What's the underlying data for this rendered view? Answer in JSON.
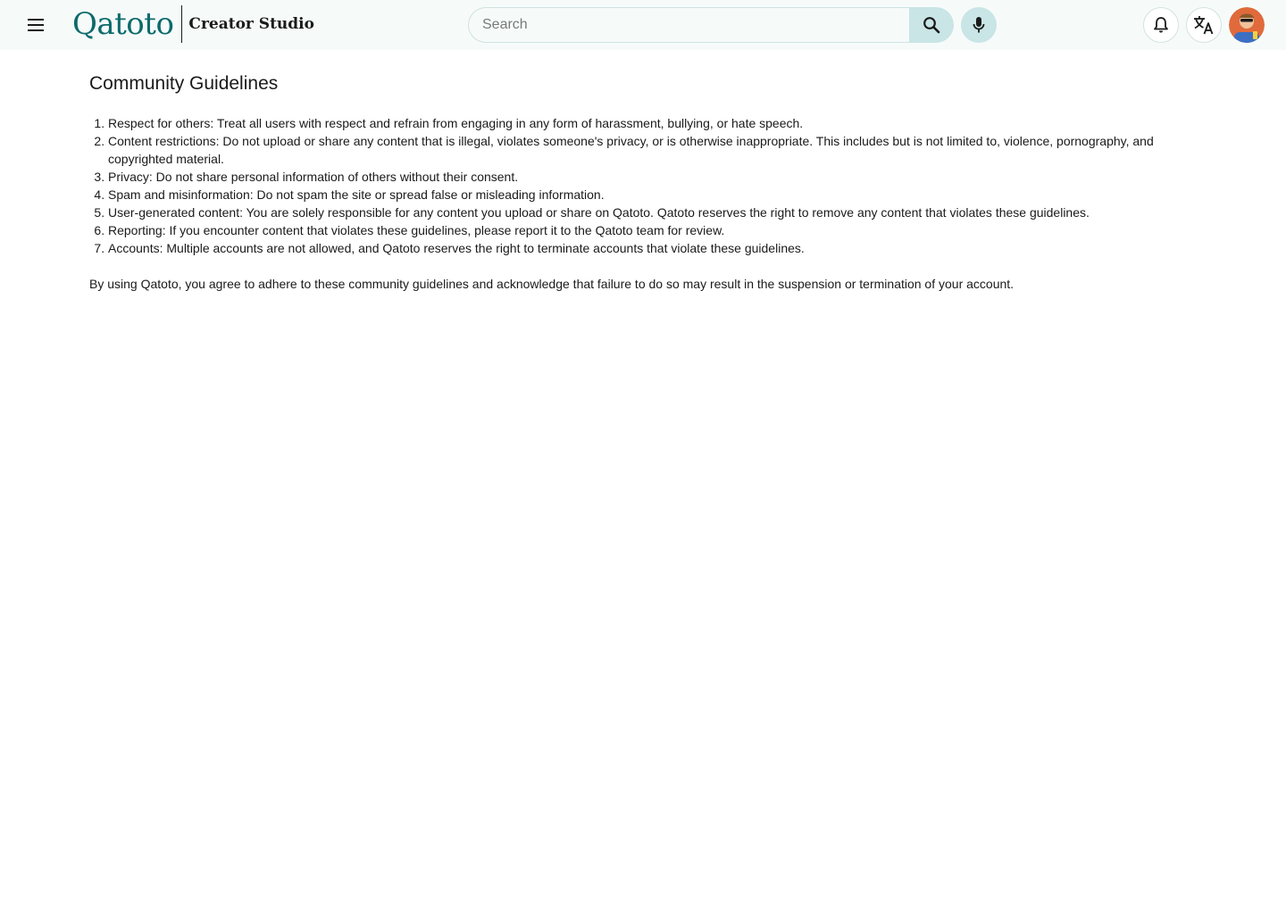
{
  "header": {
    "brand_name": "Qatoto",
    "brand_subtitle": "Creator Studio",
    "search": {
      "placeholder": "Search",
      "value": ""
    },
    "icons": {
      "menu": "menu-icon",
      "search": "search-icon",
      "mic": "mic-icon",
      "notifications": "bell-icon",
      "language": "translate-icon",
      "avatar": "avatar"
    }
  },
  "main": {
    "title": "Community Guidelines",
    "guidelines": [
      "Respect for others: Treat all users with respect and refrain from engaging in any form of harassment, bullying, or hate speech.",
      "Content restrictions: Do not upload or share any content that is illegal, violates someone's privacy, or is otherwise inappropriate. This includes but is not limited to, violence, pornography, and copyrighted material.",
      "Privacy: Do not share personal information of others without their consent.",
      "Spam and misinformation: Do not spam the site or spread false or misleading information.",
      "User-generated content: You are solely responsible for any content you upload or share on Qatoto. Qatoto reserves the right to remove any content that violates these guidelines.",
      "Reporting: If you encounter content that violates these guidelines, please report it to the Qatoto team for review.",
      "Accounts: Multiple accounts are not allowed, and Qatoto reserves the right to terminate accounts that violate these guidelines."
    ],
    "closing": "By using Qatoto, you agree to adhere to these community guidelines and acknowledge that failure to do so may result in the suspension or termination of your account."
  },
  "colors": {
    "brand": "#0d6b6b",
    "header_bg": "#f6fbfa",
    "button_accent": "#c9e5e5"
  }
}
